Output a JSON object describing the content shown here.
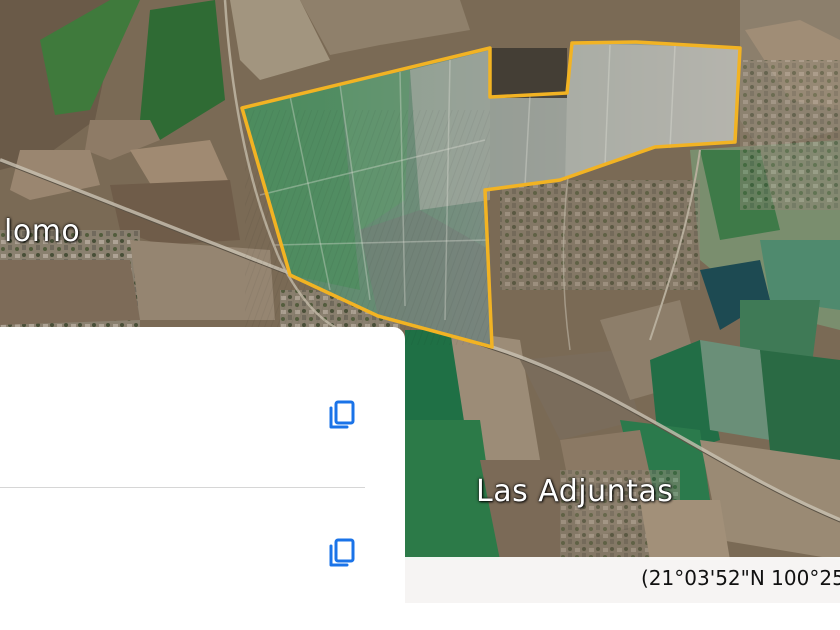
{
  "map": {
    "places": {
      "left": "lomo",
      "right": "Las Adjuntas"
    },
    "coordinates": "(21°03'52\"N 100°25",
    "boundary_color": "#f2b323"
  },
  "panel": {
    "copy_icon": "copy-icon",
    "accent_color": "#1a73e8"
  }
}
